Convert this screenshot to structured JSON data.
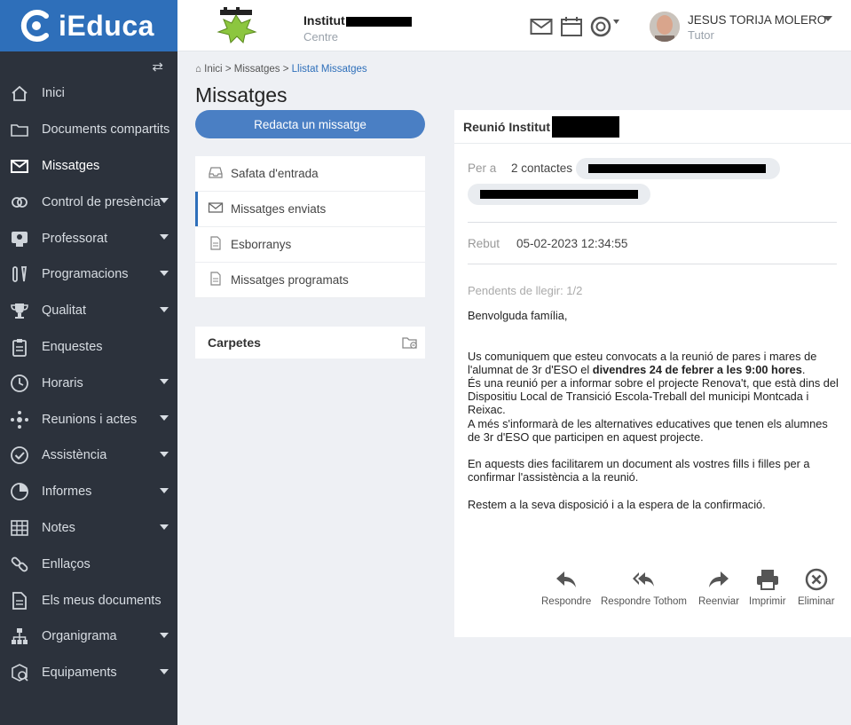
{
  "app": {
    "name": "iEduca",
    "brand_color": "#2e6fba",
    "sidebar_bg": "#2c323c"
  },
  "sidebar": {
    "items": [
      {
        "label": "Inici",
        "icon": "home-icon",
        "caret": false,
        "active": false
      },
      {
        "label": "Documents compartits",
        "icon": "folder-icon",
        "caret": false,
        "active": false
      },
      {
        "label": "Missatges",
        "icon": "envelope-icon",
        "caret": false,
        "active": true
      },
      {
        "label": "Control de presència",
        "icon": "attendance-icon",
        "caret": true,
        "active": false
      },
      {
        "label": "Professorat",
        "icon": "teacher-icon",
        "caret": true,
        "active": false
      },
      {
        "label": "Programacions",
        "icon": "tools-icon",
        "caret": true,
        "active": false
      },
      {
        "label": "Qualitat",
        "icon": "trophy-icon",
        "caret": true,
        "active": false
      },
      {
        "label": "Enquestes",
        "icon": "clipboard-icon",
        "caret": false,
        "active": false
      },
      {
        "label": "Horaris",
        "icon": "clock-icon",
        "caret": true,
        "active": false
      },
      {
        "label": "Reunions i actes",
        "icon": "meeting-icon",
        "caret": true,
        "active": false
      },
      {
        "label": "Assistència",
        "icon": "check-circle-icon",
        "caret": true,
        "active": false
      },
      {
        "label": "Informes",
        "icon": "pie-chart-icon",
        "caret": true,
        "active": false
      },
      {
        "label": "Notes",
        "icon": "grid-icon",
        "caret": true,
        "active": false
      },
      {
        "label": "Enllaços",
        "icon": "link-icon",
        "caret": false,
        "active": false
      },
      {
        "label": "Els meus documents",
        "icon": "document-icon",
        "caret": false,
        "active": false
      },
      {
        "label": "Organigrama",
        "icon": "org-chart-icon",
        "caret": true,
        "active": false
      },
      {
        "label": "Equipaments",
        "icon": "equipment-icon",
        "caret": true,
        "active": false
      }
    ]
  },
  "topbar": {
    "center_name": "Institut",
    "center_label": "Centre",
    "user_name": "JESUS TORIJA MOLERO",
    "user_role": "Tutor"
  },
  "breadcrumb": {
    "home": "Inici",
    "sep": ">",
    "section": "Missatges",
    "current": "Llistat Missatges"
  },
  "page": {
    "title": "Missatges",
    "compose_label": "Redacta un missatge"
  },
  "folders": [
    {
      "label": "Safata d'entrada",
      "icon": "inbox-icon",
      "selected": false
    },
    {
      "label": "Missatges enviats",
      "icon": "envelope-icon",
      "selected": true
    },
    {
      "label": "Esborranys",
      "icon": "draft-icon",
      "selected": false
    },
    {
      "label": "Missatges programats",
      "icon": "scheduled-icon",
      "selected": false
    }
  ],
  "carpetes": {
    "label": "Carpetes"
  },
  "message": {
    "subject": "Reunió Institut",
    "to_label": "Per a",
    "to_count": "2 contactes",
    "received_label": "Rebut",
    "received_date": "05-02-2023 12:34:55",
    "pending": "Pendents de llegir: 1/2",
    "greeting": "Benvolguda família,",
    "p1_start": "Us comuniquem que esteu convocats a la reunió de pares i mares de l'alumnat de 3r d'ESO el ",
    "p1_bold": "divendres 24 de febrer a les 9:00 hores",
    "p1_end": ".",
    "p2": "És una reunió per a informar sobre el projecte Renova't, que està dins del Dispositiu Local de Transició Escola-Treball del municipi Montcada i Reixac.",
    "p3": "A més s'informarà de les alternatives educatives que tenen els alumnes de 3r d'ESO que participen en aquest projecte.",
    "p4": "En aquests dies facilitarem un document als vostres fills i filles per a confirmar l'assistència a la reunió.",
    "p5": "Restem a la seva disposició i a la espera de la confirmació."
  },
  "actions": {
    "reply": "Respondre",
    "reply_all": "Respondre Tothom",
    "forward": "Reenviar",
    "print": "Imprimir",
    "delete": "Eliminar"
  }
}
